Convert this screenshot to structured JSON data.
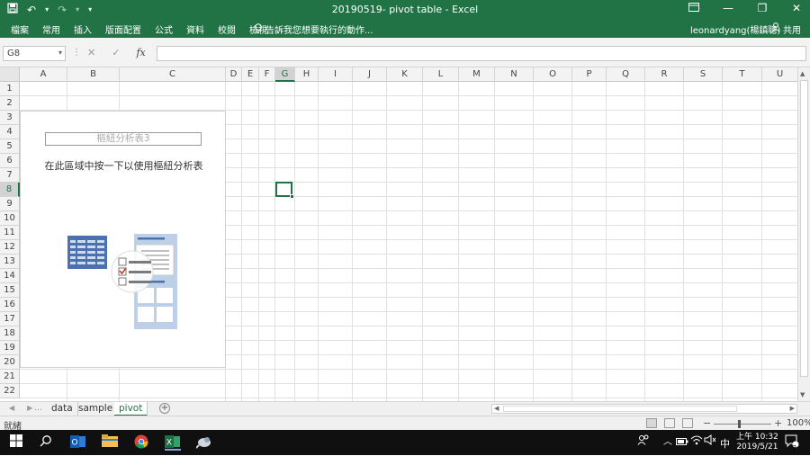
{
  "window": {
    "title": "20190519- pivot table - Excel",
    "icons": [
      "save-icon",
      "undo-icon",
      "redo-icon",
      "customize-qat-icon"
    ],
    "controls": [
      "ribbon-display-icon",
      "minimize-icon",
      "restore-icon",
      "close-icon"
    ]
  },
  "ribbon": {
    "tabs": [
      "檔案",
      "常用",
      "插入",
      "版面配置",
      "公式",
      "資料",
      "校閱",
      "檢視"
    ],
    "tell_me": "告訴我您想要執行的動作...",
    "user": "leonardyang(楊鎮聰)",
    "share": "共用"
  },
  "formula_bar": {
    "name_box": "G8",
    "cancel": "✕",
    "enter": "✓",
    "fx": "fx",
    "value": ""
  },
  "grid": {
    "columns": [
      "A",
      "B",
      "C",
      "D",
      "E",
      "F",
      "G",
      "H",
      "I",
      "J",
      "K",
      "L",
      "M",
      "N",
      "O",
      "P",
      "Q",
      "R",
      "S",
      "T",
      "U"
    ],
    "rows": [
      "1",
      "2",
      "3",
      "4",
      "5",
      "6",
      "7",
      "8",
      "9",
      "10",
      "11",
      "12",
      "13",
      "14",
      "15",
      "16",
      "17",
      "18",
      "19",
      "20",
      "21",
      "22"
    ],
    "selected_cell": "G8"
  },
  "pivot": {
    "title": "樞紐分析表3",
    "hint": "在此區域中按一下以使用樞紐分析表"
  },
  "sheets": {
    "tabs": [
      "data",
      "sample",
      "pivot"
    ],
    "active": "pivot"
  },
  "status": {
    "ready": "就緒",
    "zoom": "100%"
  },
  "taskbar": {
    "time": "上午 10:32",
    "date": "2019/5/21",
    "ime": "中",
    "notifications": "2"
  },
  "colors": {
    "accent": "#217346",
    "pivot_blue": "#5b7fb8"
  }
}
